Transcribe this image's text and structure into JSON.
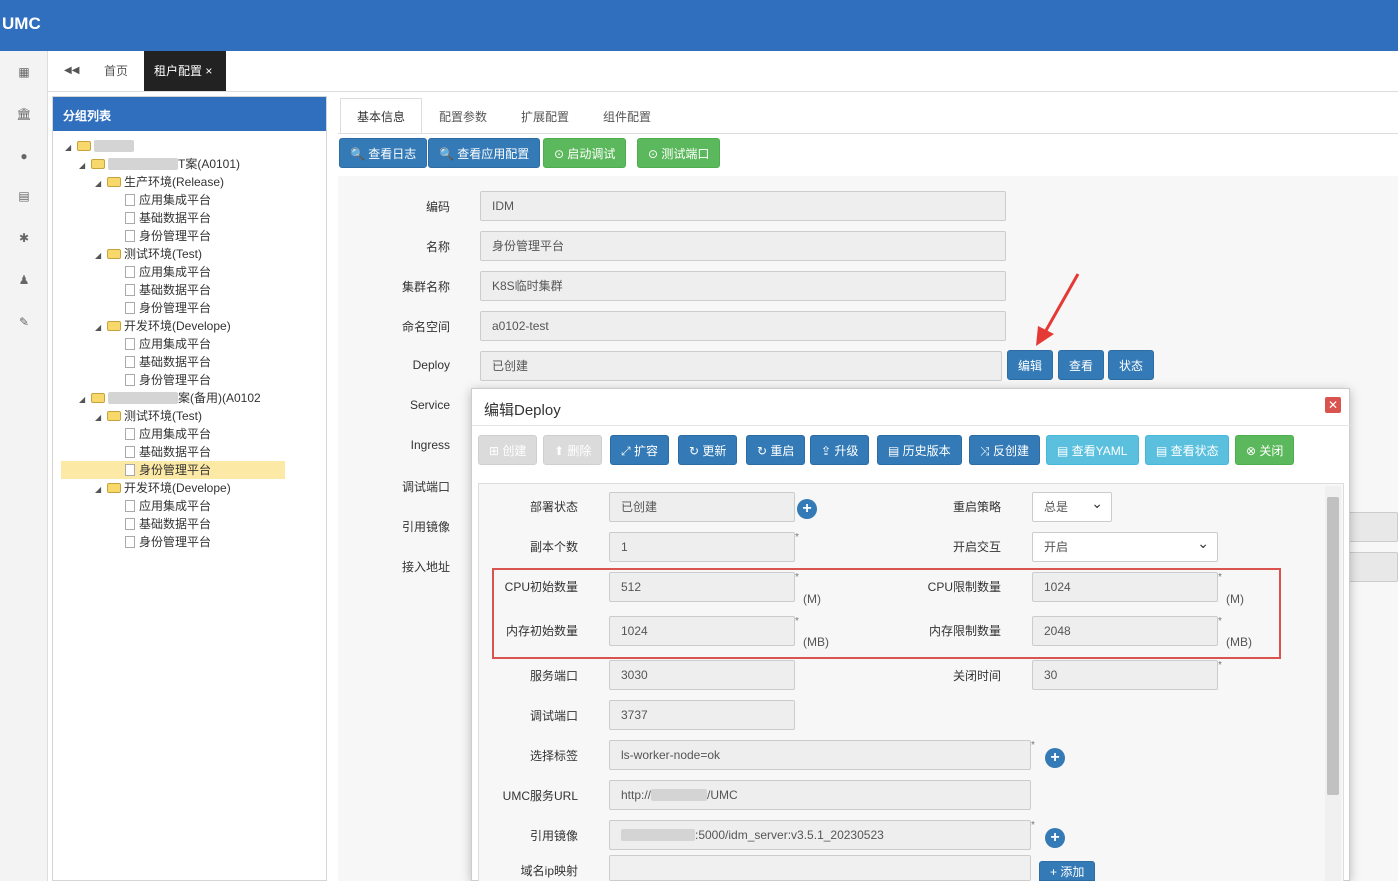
{
  "app": {
    "logo": "UMC"
  },
  "page_tabs": {
    "home": "首页",
    "active": "租户配置",
    "close": "×",
    "back_icon": "◀◀"
  },
  "left_panel": {
    "title": "分组列表",
    "tree": [
      {
        "label": "",
        "level": 0,
        "type": "folder"
      },
      {
        "label": "T案(A0101)",
        "level": 1,
        "type": "folder"
      },
      {
        "label": "生产环境(Release)",
        "level": 2,
        "type": "folder"
      },
      {
        "label": "应用集成平台",
        "level": 3,
        "type": "doc"
      },
      {
        "label": "基础数据平台",
        "level": 3,
        "type": "doc"
      },
      {
        "label": "身份管理平台",
        "level": 3,
        "type": "doc"
      },
      {
        "label": "测试环境(Test)",
        "level": 2,
        "type": "folder"
      },
      {
        "label": "应用集成平台",
        "level": 3,
        "type": "doc"
      },
      {
        "label": "基础数据平台",
        "level": 3,
        "type": "doc"
      },
      {
        "label": "身份管理平台",
        "level": 3,
        "type": "doc"
      },
      {
        "label": "开发环境(Develope)",
        "level": 2,
        "type": "folder"
      },
      {
        "label": "应用集成平台",
        "level": 3,
        "type": "doc"
      },
      {
        "label": "基础数据平台",
        "level": 3,
        "type": "doc"
      },
      {
        "label": "身份管理平台",
        "level": 3,
        "type": "doc"
      },
      {
        "label": "案(备用)(A0102",
        "level": 1,
        "type": "folder"
      },
      {
        "label": "测试环境(Test)",
        "level": 2,
        "type": "folder"
      },
      {
        "label": "应用集成平台",
        "level": 3,
        "type": "doc"
      },
      {
        "label": "基础数据平台",
        "level": 3,
        "type": "doc"
      },
      {
        "label": "身份管理平台",
        "level": 3,
        "type": "doc",
        "selected": true
      },
      {
        "label": "开发环境(Develope)",
        "level": 2,
        "type": "folder"
      },
      {
        "label": "应用集成平台",
        "level": 3,
        "type": "doc"
      },
      {
        "label": "基础数据平台",
        "level": 3,
        "type": "doc"
      },
      {
        "label": "身份管理平台",
        "level": 3,
        "type": "doc"
      }
    ]
  },
  "inner_tabs": [
    "基本信息",
    "配置参数",
    "扩展配置",
    "组件配置"
  ],
  "toolbar": {
    "view_log": "查看日志",
    "view_app_config": "查看应用配置",
    "start_debug": "启动调试",
    "test_port": "测试端口"
  },
  "form": {
    "code_label": "编码",
    "code_value": "IDM",
    "name_label": "名称",
    "name_value": "身份管理平台",
    "cluster_label": "集群名称",
    "cluster_value": "K8S临时集群",
    "ns_label": "命名空间",
    "ns_value": "a0102-test",
    "deploy_label": "Deploy",
    "deploy_value": "已创建",
    "deploy_edit": "编辑",
    "deploy_view": "查看",
    "deploy_status": "状态",
    "service_label": "Service",
    "ingress_label": "Ingress",
    "debug_port_label": "调试端口",
    "image_label": "引用镜像",
    "access_label": "接入地址"
  },
  "modal": {
    "title": "编辑Deploy",
    "close": "✕",
    "buttons": {
      "create": "创建",
      "delete": "删除",
      "scale": "扩容",
      "update": "更新",
      "restart": "重启",
      "upgrade": "升级",
      "history": "历史版本",
      "recreate": "反创建",
      "view_yaml": "查看YAML",
      "view_status": "查看状态",
      "close": "关闭"
    },
    "fields": {
      "deploy_status_label": "部署状态",
      "deploy_status_value": "已创建",
      "restart_policy_label": "重启策略",
      "restart_policy_value": "总是",
      "replicas_label": "副本个数",
      "replicas_value": "1",
      "interactive_label": "开启交互",
      "interactive_value": "开启",
      "cpu_init_label": "CPU初始数量",
      "cpu_init_value": "512",
      "cpu_init_unit": "(M)",
      "cpu_limit_label": "CPU限制数量",
      "cpu_limit_value": "1024",
      "cpu_limit_unit": "(M)",
      "mem_init_label": "内存初始数量",
      "mem_init_value": "1024",
      "mem_init_unit": "(MB)",
      "mem_limit_label": "内存限制数量",
      "mem_limit_value": "2048",
      "mem_limit_unit": "(MB)",
      "service_port_label": "服务端口",
      "service_port_value": "3030",
      "close_time_label": "关闭时间",
      "close_time_value": "30",
      "debug_port_label": "调试端口",
      "debug_port_value": "3737",
      "selector_label": "选择标签",
      "selector_value": "ls-worker-node=ok",
      "umc_url_label": "UMC服务URL",
      "umc_url_prefix": "http://",
      "umc_url_suffix": "/UMC",
      "image_label": "引用镜像",
      "image_value": ":5000/idm_server:v3.5.1_20230523",
      "hostmap_label": "域名ip映射",
      "add_button": "添加"
    }
  }
}
